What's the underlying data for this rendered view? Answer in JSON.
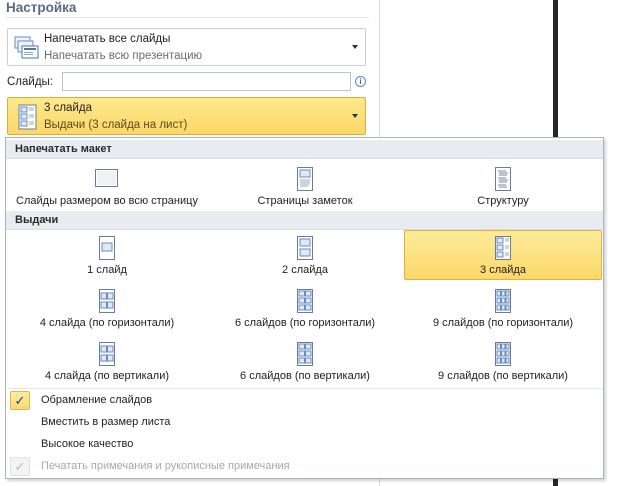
{
  "panel": {
    "title": "Настройка",
    "print_what": {
      "title": "Напечатать все слайды",
      "subtitle": "Напечатать всю презентацию"
    },
    "slides": {
      "label": "Слайды:",
      "value": "",
      "placeholder": ""
    },
    "layout": {
      "title": "3 слайда",
      "subtitle": "Выдачи (3 слайда на лист)"
    }
  },
  "gallery": {
    "print_layout": {
      "header": "Напечатать макет",
      "items": [
        {
          "label": "Слайды размером во всю страницу",
          "icon": "full-page-slide-icon"
        },
        {
          "label": "Страницы заметок",
          "icon": "notes-page-icon"
        },
        {
          "label": "Структуру",
          "icon": "outline-icon"
        }
      ]
    },
    "handouts": {
      "header": "Выдачи",
      "items": [
        {
          "label": "1 слайд",
          "icon": "handout-1-icon"
        },
        {
          "label": "2 слайда",
          "icon": "handout-2-icon"
        },
        {
          "label": "3 слайда",
          "icon": "handout-3-icon",
          "selected": true
        },
        {
          "label": "4 слайда (по горизонтали)",
          "icon": "handout-4h-icon"
        },
        {
          "label": "6 слайдов (по горизонтали)",
          "icon": "handout-6h-icon"
        },
        {
          "label": "9 слайдов (по горизонтали)",
          "icon": "handout-9h-icon"
        },
        {
          "label": "4 слайда (по вертикали)",
          "icon": "handout-4v-icon"
        },
        {
          "label": "6 слайдов (по вертикали)",
          "icon": "handout-6v-icon"
        },
        {
          "label": "9 слайдов (по вертикали)",
          "icon": "handout-9v-icon"
        }
      ]
    },
    "options": [
      {
        "label": "Обрамление слайдов",
        "checked": true,
        "enabled": true
      },
      {
        "label": "Вместить в размер листа",
        "checked": false,
        "enabled": true
      },
      {
        "label": "Высокое качество",
        "checked": false,
        "enabled": true
      },
      {
        "label": "Печатать примечания и рукописные примечания",
        "checked": true,
        "enabled": false
      }
    ]
  },
  "colors": {
    "selection_fill": "#fbd86a",
    "selection_border": "#e3b03c",
    "header_bg": "#e8ecf0",
    "title_color": "#5a6b80"
  }
}
